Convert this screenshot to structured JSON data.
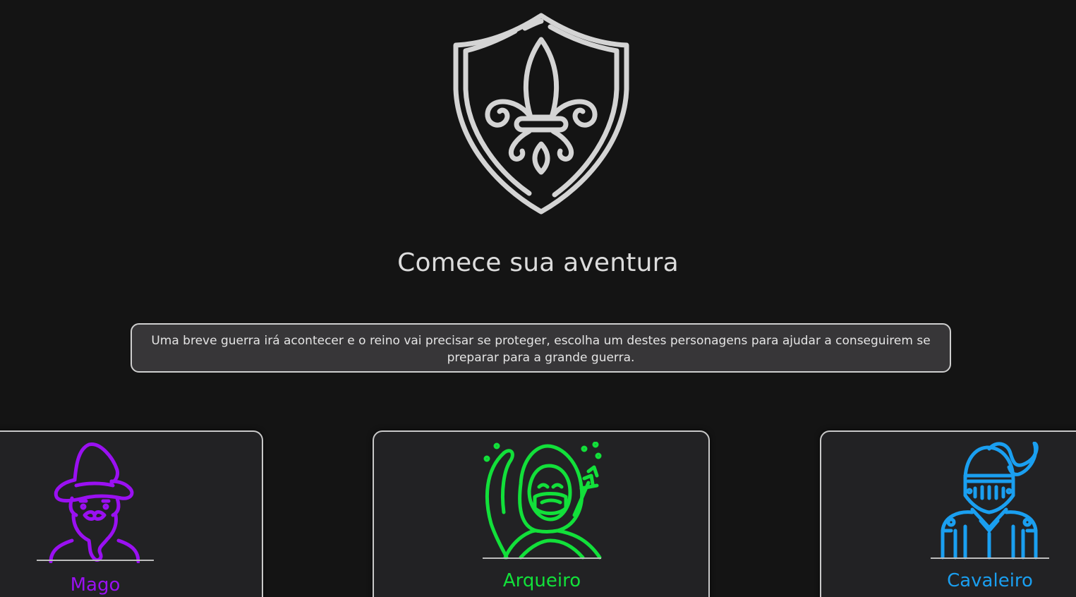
{
  "colors": {
    "background": "#141414",
    "crest": "#d4d4d4",
    "mage": "#9a10f2",
    "archer": "#12e03a",
    "knight": "#1a9ff0"
  },
  "crest": {
    "icon": "shield-fleur-de-lis-icon"
  },
  "title": "Comece sua aventura",
  "intro": "Uma breve guerra irá acontecer e o reino vai precisar se proteger, escolha um destes personagens para ajudar a conseguirem se preparar para a grande guerra.",
  "characters": [
    {
      "name": "Mago",
      "icon": "wizard-icon"
    },
    {
      "name": "Arqueiro",
      "icon": "hooded-archer-icon"
    },
    {
      "name": "Cavaleiro",
      "icon": "knight-helmet-icon"
    }
  ]
}
